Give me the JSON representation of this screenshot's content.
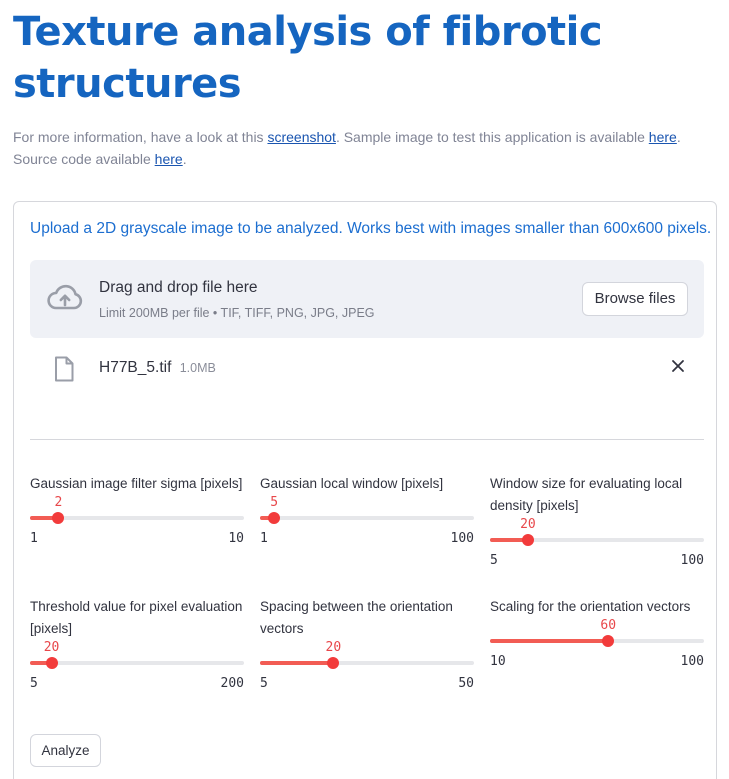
{
  "page": {
    "title": "Texture analysis of fibrotic structures",
    "intro": {
      "t1": "For more information, have a look at this ",
      "link1": "screenshot",
      "t2": ". Sample image to test this application is available ",
      "link2": "here",
      "t3": ". Source code available ",
      "link3": "here",
      "t4": "."
    }
  },
  "upload": {
    "label": "Upload a 2D grayscale image to be analyzed. Works best with images smaller than 600x600 pixels.",
    "dropzone_title": "Drag and drop file here",
    "dropzone_sub": "Limit 200MB per file • TIF, TIFF, PNG, JPG, JPEG",
    "browse_label": "Browse files",
    "icon": "cloud-upload-icon"
  },
  "file": {
    "name": "H77B_5.tif",
    "size": "1.0MB",
    "icon": "file-icon",
    "remove_icon": "close-icon"
  },
  "sliders": [
    {
      "label": "Gaussian image filter sigma [pixels]",
      "value": 2,
      "min": 1,
      "max": 10,
      "value_text": "2",
      "min_text": "1",
      "max_text": "10"
    },
    {
      "label": "Gaussian local window [pixels]",
      "value": 5,
      "min": 1,
      "max": 100,
      "value_text": "5",
      "min_text": "1",
      "max_text": "100"
    },
    {
      "label": "Window size for evaluating local density [pixels]",
      "value": 20,
      "min": 5,
      "max": 100,
      "value_text": "20",
      "min_text": "5",
      "max_text": "100"
    },
    {
      "label": "Threshold value for pixel evaluation [pixels]",
      "value": 20,
      "min": 5,
      "max": 200,
      "value_text": "20",
      "min_text": "5",
      "max_text": "200"
    },
    {
      "label": "Spacing between the orientation vectors",
      "value": 20,
      "min": 5,
      "max": 50,
      "value_text": "20",
      "min_text": "5",
      "max_text": "50"
    },
    {
      "label": "Scaling for the orientation vectors",
      "value": 60,
      "min": 10,
      "max": 100,
      "value_text": "60",
      "min_text": "10",
      "max_text": "100"
    }
  ],
  "actions": {
    "analyze_label": "Analyze"
  },
  "colors": {
    "title": "#1565c0",
    "slider_accent": "#f23b3b",
    "link": "#1a55b0"
  }
}
